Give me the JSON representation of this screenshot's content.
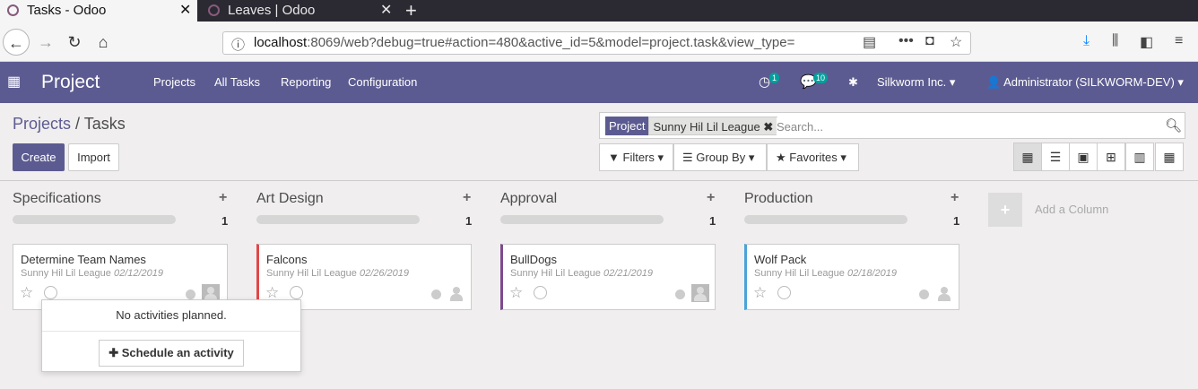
{
  "browser": {
    "tabs": [
      {
        "title": "Tasks - Odoo",
        "active": true
      },
      {
        "title": "Leaves | Odoo",
        "active": false
      }
    ],
    "url_host": "localhost",
    "url_rest": ":8069/web?debug=true#action=480&active_id=5&model=project.task&view_type="
  },
  "topbar": {
    "app_name": "Project",
    "menu": [
      "Projects",
      "All Tasks",
      "Reporting",
      "Configuration"
    ],
    "activity_count": "1",
    "messages_count": "10",
    "company": "Silkworm Inc.",
    "user": "Administrator (SILKWORM-DEV)"
  },
  "breadcrumb": {
    "parent": "Projects",
    "sep": "/",
    "current": "Tasks"
  },
  "buttons": {
    "create": "Create",
    "import": "Import"
  },
  "search": {
    "facet_label": "Project",
    "facet_value": "Sunny Hil Lil League",
    "placeholder": "Search...",
    "filters": "Filters",
    "group_by": "Group By",
    "favorites": "Favorites"
  },
  "kanban": {
    "columns": [
      {
        "title": "Specifications",
        "count": "1",
        "card": {
          "title": "Determine Team Names",
          "project": "Sunny Hil Lil League",
          "date": "02/12/2019",
          "color": ""
        }
      },
      {
        "title": "Art Design",
        "count": "1",
        "card": {
          "title": "Falcons",
          "project": "Sunny Hil Lil League",
          "date": "02/26/2019",
          "color": "#e04848"
        }
      },
      {
        "title": "Approval",
        "count": "1",
        "card": {
          "title": "BullDogs",
          "project": "Sunny Hil Lil League",
          "date": "02/21/2019",
          "color": "#7c4a8d"
        }
      },
      {
        "title": "Production",
        "count": "1",
        "card": {
          "title": "Wolf Pack",
          "project": "Sunny Hil Lil League",
          "date": "02/18/2019",
          "color": "#4ba3d8"
        }
      }
    ],
    "add_column": "Add a Column"
  },
  "popover": {
    "message": "No activities planned.",
    "button": "Schedule an activity"
  }
}
